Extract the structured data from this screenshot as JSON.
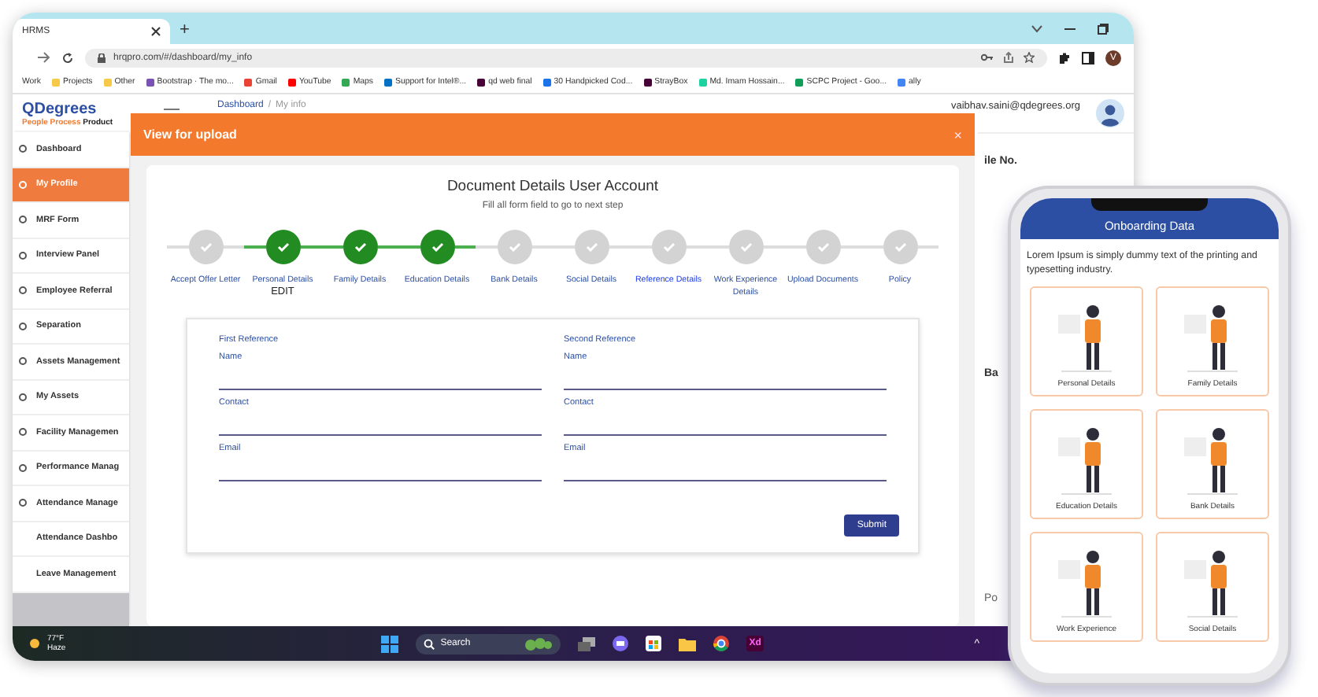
{
  "browser": {
    "tab": {
      "title": "HRMS"
    },
    "new_tab": "+",
    "url": "hrqpro.com/#/dashboard/my_info",
    "profile_initial": "V",
    "bookmarks": [
      {
        "label": "Work"
      },
      {
        "label": "Projects",
        "color": "#f7c948"
      },
      {
        "label": "Other",
        "color": "#f7c948"
      },
      {
        "label": "Bootstrap · The mo...",
        "color": "#7952b3"
      },
      {
        "label": "Gmail",
        "color": "#ea4335"
      },
      {
        "label": "YouTube",
        "color": "#ff0000"
      },
      {
        "label": "Maps",
        "color": "#34a853"
      },
      {
        "label": "Support for Intel®...",
        "color": "#0071c5"
      },
      {
        "label": "qd web final",
        "color": "#470137"
      },
      {
        "label": "30 Handpicked Cod...",
        "color": "#1a73e8"
      },
      {
        "label": "StrayBox",
        "color": "#470137"
      },
      {
        "label": "Md. Imam Hossain...",
        "color": "#1dd1a1"
      },
      {
        "label": "SCPC Project - Goo...",
        "color": "#0f9d58"
      },
      {
        "label": "ally",
        "color": "#4285f4"
      }
    ]
  },
  "app": {
    "logo": {
      "name": "QDegrees",
      "tag_1": "People Process",
      "tag_2": "Product"
    },
    "breadcrumb": {
      "items": [
        "Dashboard",
        "My info"
      ],
      "separator": "/"
    },
    "user_email": "vaibhav.saini@qdegrees.org",
    "sidebar": {
      "items": [
        {
          "label": "Dashboard",
          "selected": false,
          "icon": true
        },
        {
          "label": "My Profile",
          "selected": true,
          "icon": true
        },
        {
          "label": "MRF Form",
          "selected": false,
          "icon": true
        },
        {
          "label": "Interview Panel",
          "selected": false,
          "icon": true
        },
        {
          "label": "Employee Referral",
          "selected": false,
          "icon": true
        },
        {
          "label": "Separation",
          "selected": false,
          "icon": true
        },
        {
          "label": "Assets Management",
          "selected": false,
          "icon": true
        },
        {
          "label": "My Assets",
          "selected": false,
          "icon": true
        },
        {
          "label": "Facility Managemen",
          "selected": false,
          "icon": true
        },
        {
          "label": "Performance Manag",
          "selected": false,
          "icon": true
        },
        {
          "label": "Attendance Manage",
          "selected": false,
          "icon": true
        },
        {
          "label": "Attendance Dashbo",
          "selected": false,
          "icon": false
        },
        {
          "label": "Leave Management",
          "selected": false,
          "icon": false
        }
      ]
    },
    "background_texts": [
      "ile No.",
      "Ba",
      "Po"
    ]
  },
  "modal": {
    "title": "View for upload",
    "close": "×",
    "heading": "Document Details User Account",
    "subheading": "Fill all form field to go to next step",
    "steps": [
      {
        "label": "Accept Offer Letter",
        "done": false,
        "selected": false
      },
      {
        "label": "Personal Details",
        "done": true,
        "selected": false,
        "note": "EDIT"
      },
      {
        "label": "Family Details",
        "done": true,
        "selected": false
      },
      {
        "label": "Education Details",
        "done": true,
        "selected": false
      },
      {
        "label": "Bank Details",
        "done": false,
        "selected": false
      },
      {
        "label": "Social Details",
        "done": false,
        "selected": false
      },
      {
        "label": "Reference Details",
        "done": false,
        "selected": true
      },
      {
        "label": "Work Experience Details",
        "done": false,
        "selected": false
      },
      {
        "label": "Upload Documents",
        "done": false,
        "selected": false
      },
      {
        "label": "Policy",
        "done": false,
        "selected": false
      }
    ],
    "references": [
      {
        "heading": "First Reference",
        "fields": [
          {
            "label": "Name"
          },
          {
            "label": "Contact"
          },
          {
            "label": "Email"
          }
        ]
      },
      {
        "heading": "Second Reference",
        "fields": [
          {
            "label": "Name"
          },
          {
            "label": "Contact"
          },
          {
            "label": "Email"
          }
        ]
      }
    ],
    "submit": "Submit"
  },
  "taskbar": {
    "temperature": "77°F",
    "weather": "Haze",
    "search": "Search",
    "xd": "Xd",
    "tray": "^"
  },
  "phone": {
    "title": "Onboarding Data",
    "intro": "Lorem Ipsum is simply dummy text of the printing and typesetting industry.",
    "cards": [
      {
        "label": "Personal Details"
      },
      {
        "label": "Family Details"
      },
      {
        "label": "Education Details"
      },
      {
        "label": "Bank Details"
      },
      {
        "label": "Work Experience"
      },
      {
        "label": "Social Details"
      }
    ]
  }
}
